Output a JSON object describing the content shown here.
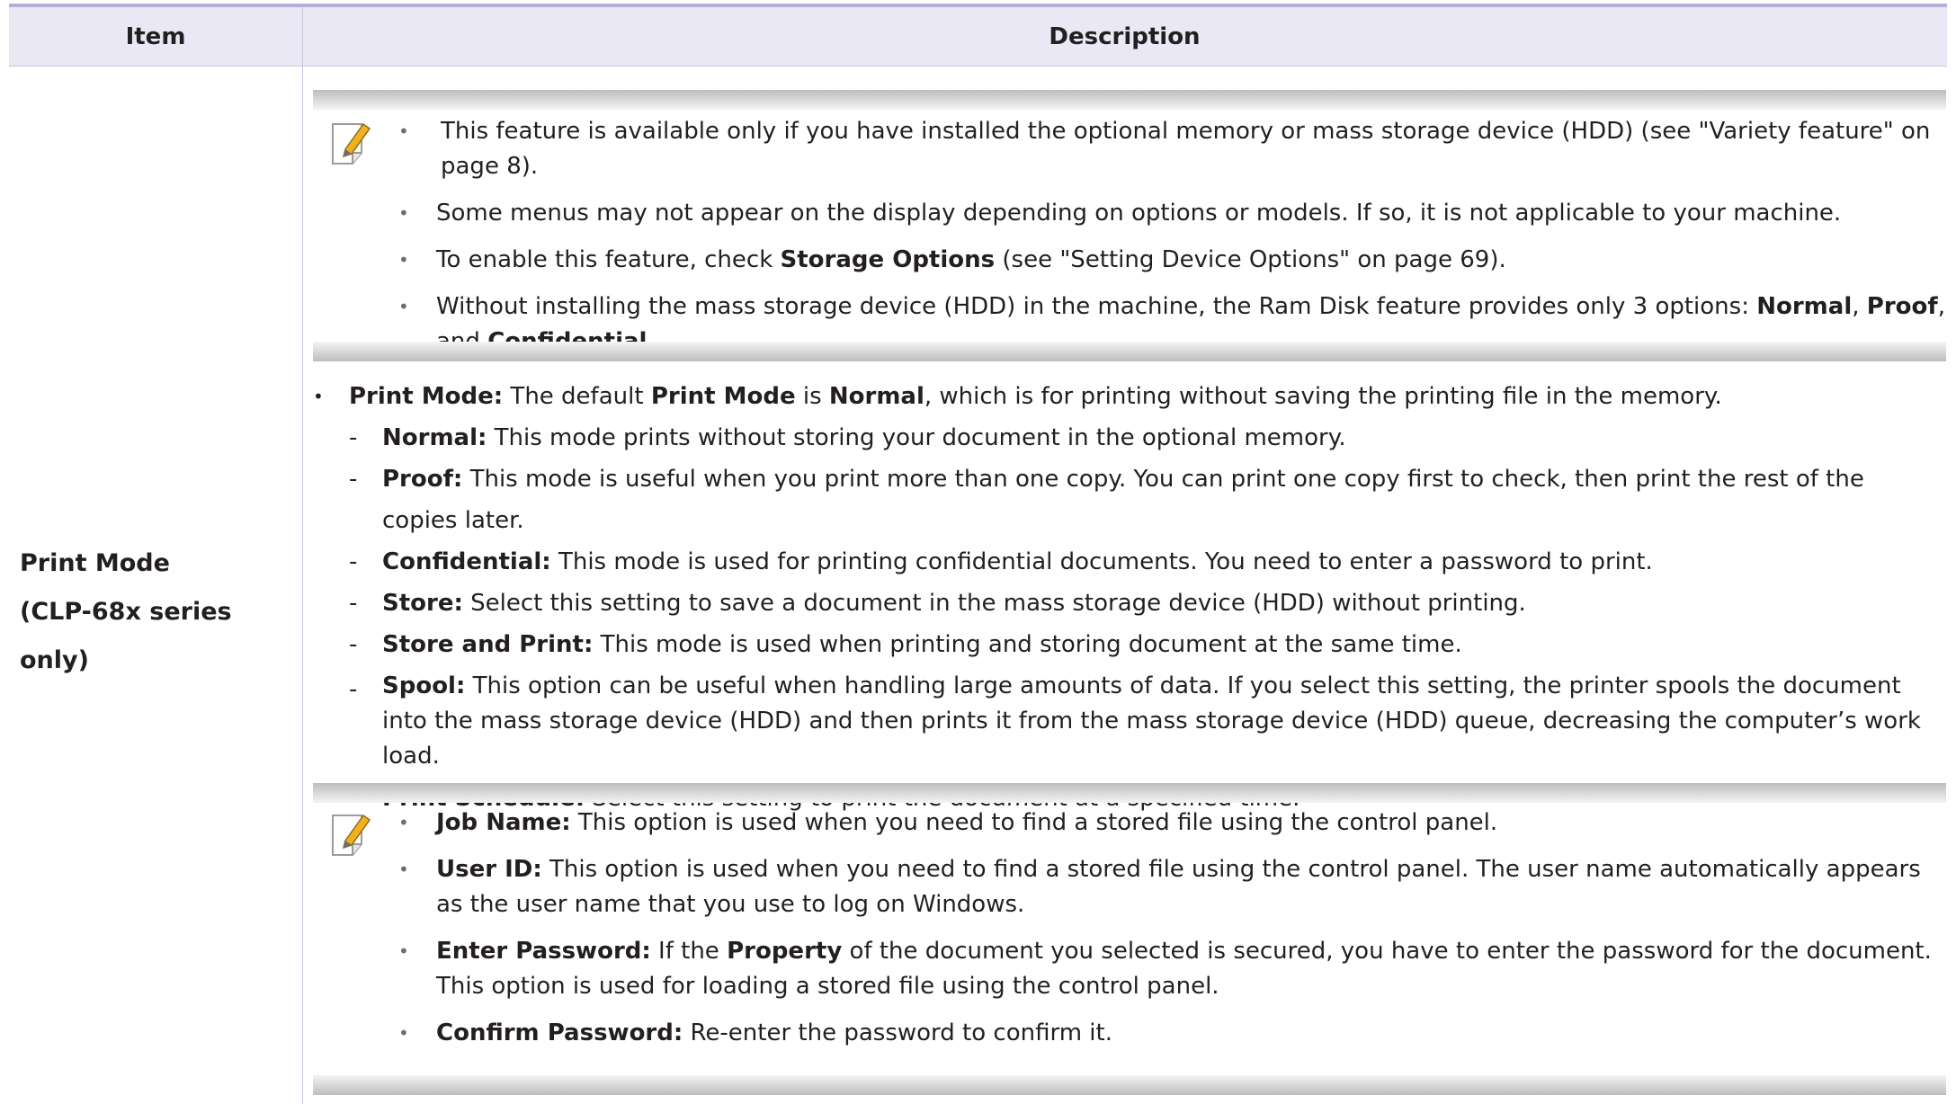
{
  "table": {
    "header_item": "Item",
    "header_description": "Description"
  },
  "item": {
    "line1": "Print Mode",
    "line2": "(CLP-68x series only)"
  },
  "note1": {
    "icon": "pencil-note-icon",
    "bullets": [
      "This feature is available only if you have installed the optional memory or mass storage device (HDD) (see \"Variety feature\" on page 8).",
      "Some menus may not appear on the display depending on options or models. If so, it is not applicable to your machine."
    ],
    "b3_pre": "To enable this feature, check ",
    "b3_bold": "Storage Options",
    "b3_post": " (see \"Setting Device Options\" on page 69).",
    "b4_pre": "Without installing the mass storage device (HDD) in the machine, the Ram Disk feature provides only 3 options: ",
    "b4_bold1": "Normal",
    "b4_sep1": ", ",
    "b4_bold2": "Proof",
    "b4_sep2": ", and ",
    "b4_bold3": "Confidential",
    "b4_end": "."
  },
  "print_mode": {
    "lead_bold": "Print Mode:",
    "lead_text1": " The default ",
    "lead_bold2": "Print Mode",
    "lead_text2": " is ",
    "lead_bold3": "Normal",
    "lead_text3": ", which is for printing without saving the printing file in the memory.",
    "modes": [
      {
        "name": "Normal:",
        "desc": " This mode prints without storing your document in the optional memory."
      },
      {
        "name": "Proof:",
        "desc": " This mode is useful when you print more than one copy. You can print one copy first to check, then print the rest of the copies later."
      },
      {
        "name": "Confidential:",
        "desc": " This mode is used for printing confidential documents. You need to enter a password to print."
      },
      {
        "name": "Store:",
        "desc": " Select this setting to save a document in the mass storage device (HDD) without printing."
      },
      {
        "name": "Store and Print:",
        "desc": " This mode is used when printing and storing document at the same time."
      },
      {
        "name": "Spool:",
        "desc": " This option can be useful when handling large amounts of data. If you select this setting, the printer spools the document into the mass storage device (HDD) and then prints it from the mass storage device (HDD) queue, decreasing the computer’s work load."
      },
      {
        "name": "Print Schedule:",
        "desc": " Select this setting to print the document at a specified time."
      }
    ]
  },
  "note2": {
    "icon": "pencil-note-icon",
    "items": [
      {
        "name": "Job Name:",
        "desc": " This option is used when you need to find a stored file using the control panel."
      },
      {
        "name": "User ID:",
        "desc": " This option is used when you need to find a stored file using the control panel. The user name automatically appears as the user name that you use to log on Windows."
      }
    ],
    "ep_name": "Enter Password:",
    "ep_text1": " If the ",
    "ep_bold": "Property",
    "ep_text2": " of the document you selected is secured, you have to enter the password for the document.  This option is used for loading a stored file using the control panel.",
    "cp_name": "Confirm Password:",
    "cp_text": " Re-enter the password to confirm it."
  },
  "colors": {
    "header_bg": "#e9e8f4",
    "header_rule": "#b5aed6",
    "note_icon_accent": "#f2b01e"
  }
}
